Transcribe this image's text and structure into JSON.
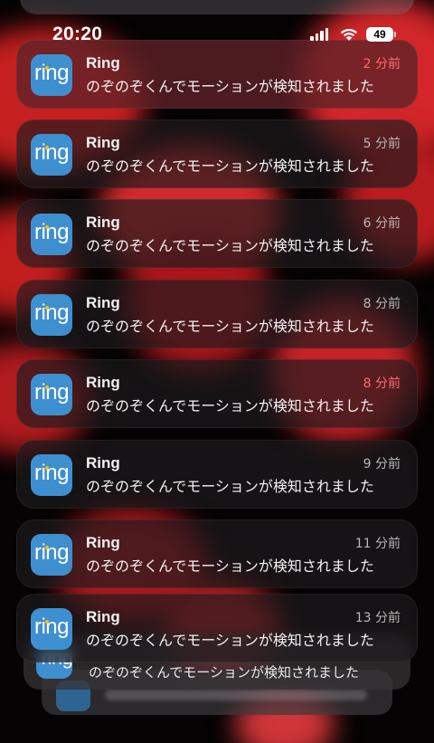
{
  "status_bar": {
    "time": "20:20",
    "battery": "49"
  },
  "app": {
    "name": "Ring",
    "icon_text": "ring",
    "icon_color": "#3e8fd0"
  },
  "notifications": [
    {
      "app": "Ring",
      "time": "2 分前",
      "message": "のぞのぞくんでモーションが検知されました"
    },
    {
      "app": "Ring",
      "time": "5 分前",
      "message": "のぞのぞくんでモーションが検知されました"
    },
    {
      "app": "Ring",
      "time": "6 分前",
      "message": "のぞのぞくんでモーションが検知されました"
    },
    {
      "app": "Ring",
      "time": "8 分前",
      "message": "のぞのぞくんでモーションが検知されました"
    },
    {
      "app": "Ring",
      "time": "8 分前",
      "message": "のぞのぞくんでモーションが検知されました"
    },
    {
      "app": "Ring",
      "time": "9 分前",
      "message": "のぞのぞくんでモーションが検知されました"
    },
    {
      "app": "Ring",
      "time": "11 分前",
      "message": "のぞのぞくんでモーションが検知されました"
    },
    {
      "app": "Ring",
      "time": "13 分前",
      "message": "のぞのぞくんでモーションが検知されました"
    }
  ],
  "stacked": {
    "message": "のぞのぞくんでモーションが検知されました"
  }
}
